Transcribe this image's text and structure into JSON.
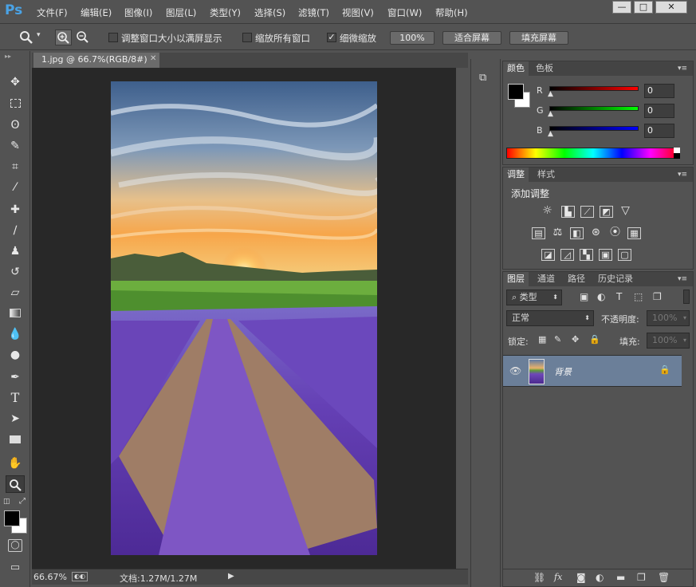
{
  "app": {
    "logo": "Ps"
  },
  "menu": [
    "文件(F)",
    "编辑(E)",
    "图像(I)",
    "图层(L)",
    "类型(Y)",
    "选择(S)",
    "滤镜(T)",
    "视图(V)",
    "窗口(W)",
    "帮助(H)"
  ],
  "window_controls": [
    "minimize-icon",
    "restore-icon",
    "close-icon"
  ],
  "options": {
    "resize_windows_label": "调整窗口大小以满屏显示",
    "zoom_all_label": "缩放所有窗口",
    "scrubby_zoom_label": "细微缩放",
    "zoom_100_label": "100%",
    "fit_screen_label": "适合屏幕",
    "fill_screen_label": "填充屏幕",
    "scrubby_zoom_checked": true
  },
  "document": {
    "tab_title": "1.jpg @ 66.7%(RGB/8#)",
    "zoom": "66.67%",
    "doc_size": "文档:1.27M/1.27M"
  },
  "tools": [
    "move-tool",
    "marquee-tool",
    "lasso-tool",
    "quick-select-tool",
    "crop-tool",
    "eyedropper-tool",
    "healing-brush-tool",
    "brush-tool",
    "clone-stamp-tool",
    "history-brush-tool",
    "eraser-tool",
    "gradient-tool",
    "blur-tool",
    "dodge-tool",
    "pen-tool",
    "type-tool",
    "path-select-tool",
    "rectangle-tool",
    "hand-tool",
    "zoom-tool"
  ],
  "color_panel": {
    "tabs": [
      "颜色",
      "色板"
    ],
    "channels": [
      {
        "label": "R",
        "value": "0",
        "color": "#ff0000"
      },
      {
        "label": "G",
        "value": "0",
        "color": "#00ff00"
      },
      {
        "label": "B",
        "value": "0",
        "color": "#0000ff"
      }
    ]
  },
  "adjust_panel": {
    "tabs": [
      "调整",
      "样式"
    ],
    "heading": "添加调整"
  },
  "layers_panel": {
    "tabs": [
      "图层",
      "通道",
      "路径",
      "历史记录"
    ],
    "filter_label": "类型",
    "blend_mode": "正常",
    "opacity_label": "不透明度:",
    "opacity_value": "100%",
    "lock_label": "锁定:",
    "fill_label": "填充:",
    "fill_value": "100%",
    "layers": [
      {
        "name": "背景",
        "visible": true,
        "locked": true
      }
    ]
  },
  "colors": {
    "accent_blue": "#4aa3e6",
    "layer_selected": "#6b7f99"
  }
}
